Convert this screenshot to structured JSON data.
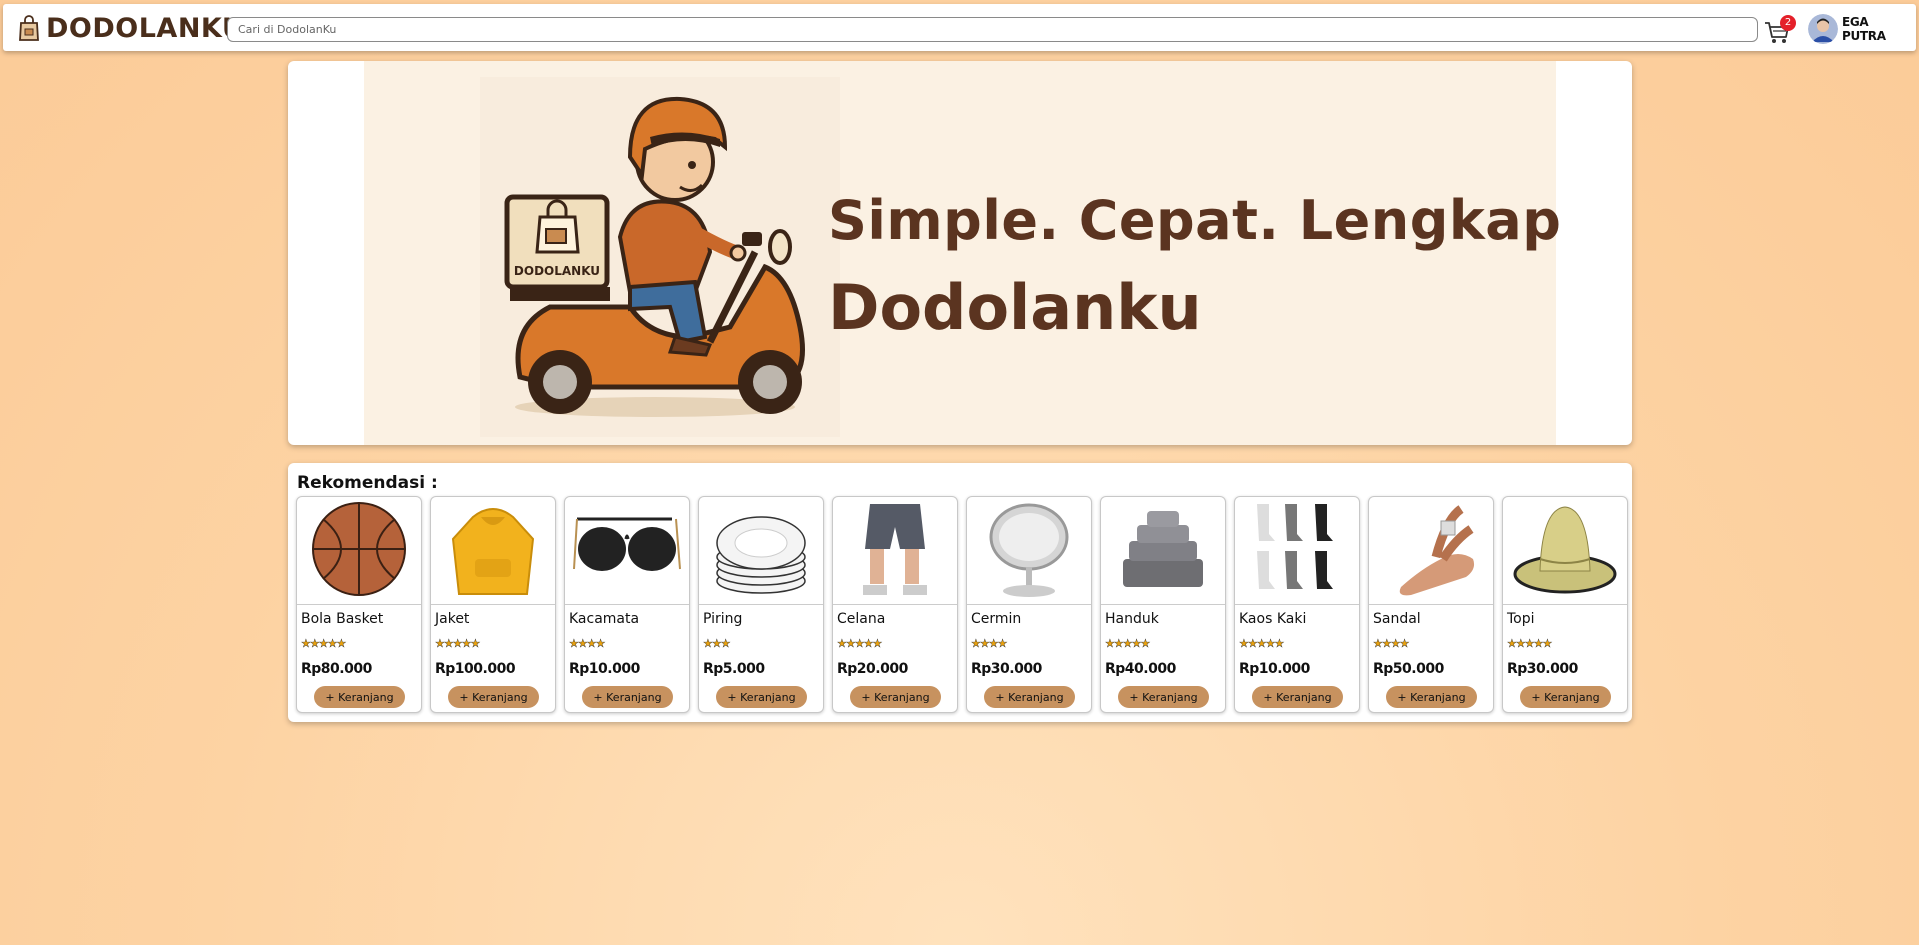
{
  "header": {
    "brand": "DODOLANKU",
    "search_placeholder": "Cari di DodolanKu",
    "cart_count": "2",
    "user_name": "EGA PUTRA"
  },
  "banner": {
    "headline": "Simple. Cepat. Lengkap",
    "brand_large": "Dodolanku",
    "box_label": "DODOLANKU"
  },
  "recommendations": {
    "title": "Rekomendasi :",
    "add_label": "+ Keranjang",
    "products": [
      {
        "name": "Bola Basket",
        "rating": 5,
        "price": "Rp80.000",
        "icon": "basketball-icon"
      },
      {
        "name": "Jaket",
        "rating": 5,
        "price": "Rp100.000",
        "icon": "hoodie-icon"
      },
      {
        "name": "Kacamata",
        "rating": 4,
        "price": "Rp10.000",
        "icon": "sunglasses-icon"
      },
      {
        "name": "Piring",
        "rating": 3,
        "price": "Rp5.000",
        "icon": "plates-icon"
      },
      {
        "name": "Celana",
        "rating": 5,
        "price": "Rp20.000",
        "icon": "shorts-icon"
      },
      {
        "name": "Cermin",
        "rating": 4,
        "price": "Rp30.000",
        "icon": "mirror-icon"
      },
      {
        "name": "Handuk",
        "rating": 5,
        "price": "Rp40.000",
        "icon": "towel-icon"
      },
      {
        "name": "Kaos Kaki",
        "rating": 5,
        "price": "Rp10.000",
        "icon": "socks-icon"
      },
      {
        "name": "Sandal",
        "rating": 4,
        "price": "Rp50.000",
        "icon": "sandal-icon"
      },
      {
        "name": "Topi",
        "rating": 5,
        "price": "Rp30.000",
        "icon": "hat-icon"
      }
    ]
  },
  "colors": {
    "brand_brown": "#4a2e1b",
    "headline_brown": "#5b3420",
    "button_tan": "#c7925f",
    "badge_red": "#e4202a",
    "background_peach": "#fdd3a3"
  }
}
